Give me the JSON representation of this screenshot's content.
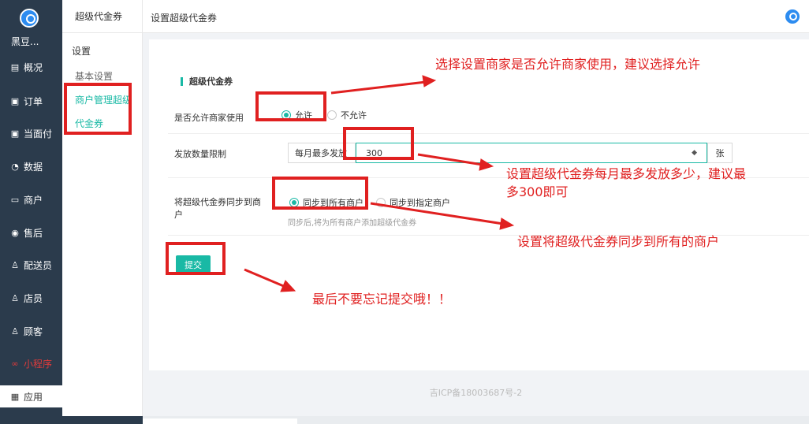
{
  "nav": {
    "brand": "黑豆...",
    "items": [
      {
        "label": "概况",
        "icon": "dashboard-icon",
        "glyph": "▤"
      },
      {
        "label": "订单",
        "icon": "order-icon",
        "glyph": "▣"
      },
      {
        "label": "当面付",
        "icon": "pay-icon",
        "glyph": "▣"
      },
      {
        "label": "数据",
        "icon": "data-icon",
        "glyph": "◔"
      },
      {
        "label": "商户",
        "icon": "merchant-icon",
        "glyph": "▭"
      },
      {
        "label": "售后",
        "icon": "after-sale-icon",
        "glyph": "◉"
      },
      {
        "label": "配送员",
        "icon": "courier-icon",
        "glyph": "♙"
      },
      {
        "label": "店员",
        "icon": "clerk-icon",
        "glyph": "♙"
      },
      {
        "label": "顾客",
        "icon": "customer-icon",
        "glyph": "♙"
      },
      {
        "label": "小程序",
        "icon": "miniprogram-icon",
        "glyph": "∞"
      },
      {
        "label": "应用",
        "icon": "apps-icon",
        "glyph": "▦"
      }
    ]
  },
  "subnav": {
    "header": "超级代金券",
    "group": "设置",
    "links": [
      "基本设置",
      "商户管理超级",
      "代金券"
    ]
  },
  "topbar": {
    "title": "设置超级代金券"
  },
  "form": {
    "section_title": "超级代金券",
    "allow_label": "是否允许商家使用",
    "allow_options": [
      "允许",
      "不允许"
    ],
    "limit_label": "发放数量限制",
    "limit_prefix": "每月最多发放",
    "limit_value": "300",
    "limit_unit": "张",
    "sync_label": "将超级代金券同步到商户",
    "sync_options": [
      "同步到所有商户",
      "同步到指定商户"
    ],
    "sync_hint": "同步后,将为所有商户添加超级代金券",
    "submit": "提交"
  },
  "footer": {
    "icp": "吉ICP备18003687号-2"
  },
  "annotations": {
    "note1": "选择设置商家是否允许商家使用，建议选择允许",
    "note2a": "设置超级代金券每月最多发放多少，建议最",
    "note2b": "多300即可",
    "note3": "设置将超级代金券同步到所有的商户",
    "note4": "最后不要忘记提交哦！！"
  },
  "colors": {
    "accent": "#19b9a5",
    "nav_bg": "#2b3b4c",
    "annotation": "#e02020"
  }
}
